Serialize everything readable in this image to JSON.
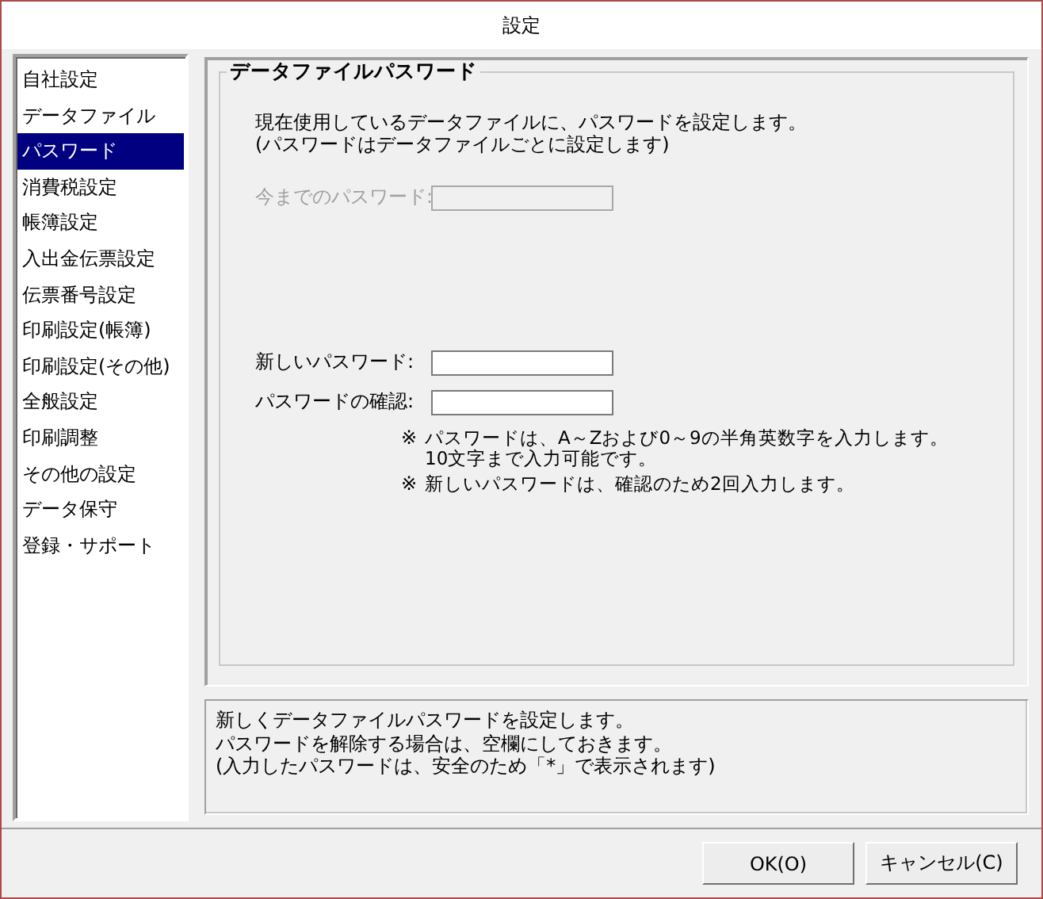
{
  "window": {
    "title": "設定"
  },
  "sidebar": {
    "items": [
      {
        "label": "自社設定",
        "selected": false
      },
      {
        "label": "データファイル",
        "selected": false
      },
      {
        "label": "パスワード",
        "selected": true
      },
      {
        "label": "消費税設定",
        "selected": false
      },
      {
        "label": "帳簿設定",
        "selected": false
      },
      {
        "label": "入出金伝票設定",
        "selected": false
      },
      {
        "label": "伝票番号設定",
        "selected": false
      },
      {
        "label": "印刷設定(帳簿)",
        "selected": false
      },
      {
        "label": "印刷設定(その他)",
        "selected": false
      },
      {
        "label": "全般設定",
        "selected": false
      },
      {
        "label": "印刷調整",
        "selected": false
      },
      {
        "label": "その他の設定",
        "selected": false
      },
      {
        "label": "データ保守",
        "selected": false
      },
      {
        "label": "登録・サポート",
        "selected": false
      }
    ]
  },
  "group": {
    "title": "データファイルパスワード",
    "intro": [
      "現在使用しているデータファイルに、パスワードを設定します。",
      "(パスワードはデータファイルごとに設定します)"
    ],
    "old_field": {
      "label": "今までのパスワード:",
      "disabled": true
    },
    "fields": [
      {
        "label": "新しいパスワード:",
        "disabled": false
      },
      {
        "label": "パスワードの確認:",
        "disabled": false
      }
    ],
    "notes": [
      {
        "mark": "※",
        "lines": [
          "パスワードは、A～Zおよび0～9の半角英数字を入力します。",
          "10文字まで入力可能です。"
        ]
      },
      {
        "mark": "※",
        "lines": [
          "新しいパスワードは、確認のため2回入力します。"
        ]
      }
    ]
  },
  "hint": [
    "新しくデータファイルパスワードを設定します。",
    "パスワードを解除する場合は、空欄にしておきます。",
    "(入力したパスワードは、安全のため「*」で表示されます)"
  ],
  "buttons": [
    "OK(O)",
    "キャンセル(C)"
  ]
}
